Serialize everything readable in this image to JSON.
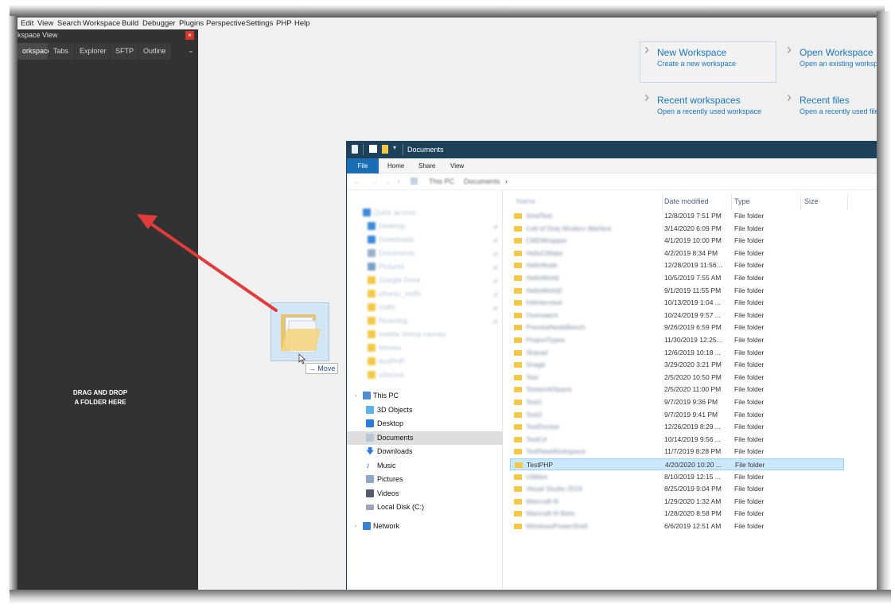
{
  "menubar": {
    "items": [
      "Edit",
      "View",
      "Search",
      "Workspace",
      "Build",
      "Debugger",
      "Plugins",
      "Perspective",
      "Settings",
      "PHP",
      "Help"
    ]
  },
  "sidebar": {
    "title": "kspace View",
    "close": "×",
    "tabs": [
      "orkspace",
      "Tabs",
      "Explorer",
      "SFTP",
      "Outline"
    ],
    "chevron": "⌄",
    "drop_hint_line1": "DRAG AND DROP",
    "drop_hint_line2": "A FOLDER HERE"
  },
  "quick_actions": [
    {
      "title": "New Workspace",
      "subtitle": "Create a new workspace"
    },
    {
      "title": "Open Workspace",
      "subtitle": "Open an existing worksp"
    },
    {
      "title": "Recent workspaces",
      "subtitle": "Open a recently used workspace"
    },
    {
      "title": "Recent files",
      "subtitle": "Open a recently used file"
    }
  ],
  "explorer": {
    "title": "Documents",
    "ribbon": [
      "File",
      "Home",
      "Share",
      "View"
    ],
    "breadcrumb": [
      "This PC",
      "Documents"
    ],
    "nav_quick": [
      "Quick access",
      "Desktop",
      "Downloads",
      "Documents",
      "Pictures",
      "Google Drive",
      "ubuntu_ssdfs",
      "ssdfs",
      "Roaming",
      "mobile dvtmp canvas",
      "Movies",
      "testPHP",
      "u3scoot"
    ],
    "nav_pc": [
      {
        "label": "This PC",
        "icon": "computer-icon"
      },
      {
        "label": "3D Objects",
        "icon": "3d-objects-icon"
      },
      {
        "label": "Desktop",
        "icon": "desktop-icon"
      },
      {
        "label": "Documents",
        "icon": "documents-icon"
      },
      {
        "label": "Downloads",
        "icon": "downloads-icon"
      },
      {
        "label": "Music",
        "icon": "music-icon"
      },
      {
        "label": "Pictures",
        "icon": "pictures-icon"
      },
      {
        "label": "Videos",
        "icon": "videos-icon"
      },
      {
        "label": "Local Disk (C:)",
        "icon": "disk-icon"
      },
      {
        "label": "Network",
        "icon": "network-icon"
      }
    ],
    "columns": [
      "Name",
      "Date modified",
      "Type",
      "Size"
    ],
    "rows": [
      {
        "name": "AmdTest",
        "date": "12/8/2019 7:51 PM",
        "type": "File folder"
      },
      {
        "name": "Call of Duty Modern Warfare",
        "date": "3/14/2020 6:09 PM",
        "type": "File folder"
      },
      {
        "name": "CMDWrapper",
        "date": "4/1/2019 10:00 PM",
        "type": "File folder"
      },
      {
        "name": "HelloCMake",
        "date": "4/2/2019 8:34 PM",
        "type": "File folder"
      },
      {
        "name": "HelloNode",
        "date": "12/28/2019 11:56...",
        "type": "File folder"
      },
      {
        "name": "HelloWorld",
        "date": "10/5/2019 7:55 AM",
        "type": "File folder"
      },
      {
        "name": "HelloWorld2",
        "date": "9/1/2019 11:55 PM",
        "type": "File folder"
      },
      {
        "name": "InkInterview",
        "date": "10/13/2019 1:04 ...",
        "type": "File folder"
      },
      {
        "name": "Overwatch",
        "date": "10/24/2019 9:57 ...",
        "type": "File folder"
      },
      {
        "name": "PreviewNodeBench",
        "date": "9/26/2019 6:59 PM",
        "type": "File folder"
      },
      {
        "name": "ProjectTypes",
        "date": "11/30/2019 12:25...",
        "type": "File folder"
      },
      {
        "name": "Shared",
        "date": "12/6/2019 10:18 ...",
        "type": "File folder"
      },
      {
        "name": "Snagit",
        "date": "3/29/2020 3:21 PM",
        "type": "File folder"
      },
      {
        "name": "Test",
        "date": "2/5/2020 10:50 PM",
        "type": "File folder"
      },
      {
        "name": "TestworkSpace",
        "date": "2/5/2020 11:00 PM",
        "type": "File folder"
      },
      {
        "name": "Test1",
        "date": "9/7/2019 9:36 PM",
        "type": "File folder"
      },
      {
        "name": "Test2",
        "date": "9/7/2019 9:41 PM",
        "type": "File folder"
      },
      {
        "name": "TestDocker",
        "date": "12/26/2019 8:29 ...",
        "type": "File folder"
      },
      {
        "name": "TestC#",
        "date": "10/14/2019 9:56 ...",
        "type": "File folder"
      },
      {
        "name": "TestNewWorkspace",
        "date": "11/7/2019 8:28 PM",
        "type": "File folder"
      },
      {
        "name": "TestPHP",
        "date": "4/20/2020 10:20 ...",
        "type": "File folder",
        "selected": true,
        "clear": true
      },
      {
        "name": "Utilities",
        "date": "8/10/2019 12:15 ...",
        "type": "File folder"
      },
      {
        "name": "Visual Studio 2019",
        "date": "8/25/2019 9:04 PM",
        "type": "File folder"
      },
      {
        "name": "Warcraft III",
        "date": "1/29/2020 1:32 AM",
        "type": "File folder"
      },
      {
        "name": "Warcraft III Beta",
        "date": "1/28/2020 8:58 PM",
        "type": "File folder"
      },
      {
        "name": "WindowsPowerShell",
        "date": "6/6/2019 12:51 AM",
        "type": "File folder"
      }
    ]
  },
  "drag": {
    "badge": "Move",
    "badge_icon": "→"
  },
  "colors": {
    "accent": "#1a75c0",
    "sidebar_bg": "#323232",
    "explorer_title": "#1d4158",
    "arrow": "#e03c3c",
    "selection": "#cce8ff"
  }
}
